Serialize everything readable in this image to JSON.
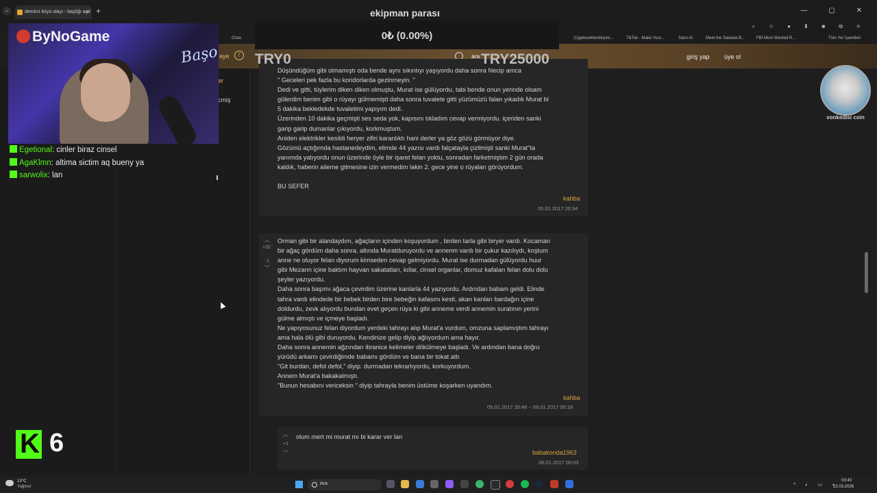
{
  "browser": {
    "tab_title": "demirci köyü olayı - başlığı açıl",
    "new_tab": "+",
    "window_controls": "— ▢ ✕",
    "bookmarks": [
      "Chao",
      "(1)gelecektenbiryolc...",
      "TikTok - Make Your...",
      "Satın Al",
      "Meet the Sakawa B...",
      "FBI Most Wanted R..."
    ],
    "all_bookmarks": "Tüm Yer İşaretleri",
    "tool_icons": "⌕ ☆ ● ⬇ ■ ⧉ ≡"
  },
  "site_header": {
    "left_text": "aye",
    "search_label": "ara",
    "login": "giriş yap",
    "signup": "üye ol"
  },
  "left_nav": {
    "item1": "er",
    "item2": "cmiş"
  },
  "entries": [
    {
      "text": "Düşündüğüm gibi olmamıştı oda bende aynı sıkıntıyı yaşıyordu daha sonra Necip amca\n\" Geceleri pek fazla bu koridorlarda gezinmeyin. \"\nDedi ve gitti, tüylerim diken diken olmuştu, Murat ise gülüyordu, tabi bende onun yerinde olsam\ngülerdim benim gibi o rüyayı gülmemişti daha sonra tuvalete gitti yüzümüzü falan yıkadık Murat bi\n5 dakika bekledekde tuvaletimi yapıyım dedi.\nÜzerinden 10 dakika geçmişti ses seda yok, kapısını tıkladım cevap vermiyordu. içeriden sanki\ngarip garip dumanlar çıkıyordu, korkmuştum.\nAniden elektrikler kesildi heryer zifiri karanlıktı hani derler ya göz gözü görmüyor diye.\nGözümü açtığımda hastanedeydim, elimde 44 yazısı vardı falçatayla çizilmişti sanki Murat\"ta\nyanımda yatıyordu onun üzerinde öyle bir işaret felan yoktu, sonradan farketmiştim 2 gün orada\nkaldık, haberin aileme gitmesine izin vermedim lakin 2. gece yine o rüyaları görüyordum.\n\nBU SEFER",
      "author": "kahba",
      "date": "05.01.2017 20:34"
    },
    {
      "text": "Orman gibi bir alandaydım, ağaçların içinden koşuyordum , birden tarla gibi biryer vardı. Kocaman\nbir ağaç gördüm daha sonra, altında Muratduruyordu ve annenm vardı bir çukur kazılıydı, koştum\nanne ne oluyor felan diyorum kimseden cevap gelmiyordu. Murat ise durmadan gülüyordu huur\ngibi Mezarın içine baktım hayvan sakatatları, kıllar, cinsel organlar, domuz kafaları felan dolu dolu\nşeyler yazıyordu.\nDaha sonra başımı ağaca çevirdim üzerine kanlarla 44 yazıyordu. Ardından babam geldi. Elinde\ntahra vardı elindede bir bebek birden bire bebeğin kafasını kesti, akan kanları bardağın içine\ndoldurdu, zevk alıyordu bundan evet geçen rüya ki gibi anneme verdi annemin suratının yerini\ngülme almıştı ve içmeye başladı.\nNe yapıyosunuz felan diyordum yerdeki tahrayı alıp Murat'a vurdum, omzuna saplamıştım tahrayı\nama hala ölü gibi duruyordu. Kendinize gelip diyip ağlıyordum ama hayır.\nDaha sonra annemin ağzından ibranice kelimeler dökülmeye başladı. Ve ardından bana doğru\nyürüdü arkamı çevirdiğimde babamı gördüm ve bana bir tokat attı\n\"Git burdan, defol defol,\" diyip. durmadan tekrarlıyordu, korkuyordum.\nAnnem Murat'a bakakalmıştı.\n\"Bunun hesabını vericeksin \" diyip tahrayla benim üstüme koşarken uyandım.",
      "author": "kahba",
      "date": "05.01.2017 20:46 ~ 06.01.2017 00:16",
      "upvotes": "+32",
      "downvotes": "-1"
    },
    {
      "text": "olum mert mi murat mı bi karar ver lan",
      "author": "babakonda1963",
      "date": "06.01.2017 00:03",
      "upvotes": "+1"
    }
  ],
  "overlay": {
    "title": "ekipman parası",
    "value": "0₺ (0.00%)",
    "min": "TRY0",
    "max": "TRY25000"
  },
  "stream": {
    "logo": "ByNoGame",
    "neon_sign": "Başo",
    "chat": [
      {
        "user": "Egetional",
        "message": "cinler biraz cinsel"
      },
      {
        "user": "AgaKlmn",
        "message": "altima sictim aq bueny ya"
      },
      {
        "user": "sarwolix",
        "message": "lan"
      }
    ],
    "viewer_count": "6",
    "badge_label": "vonkedisi coin"
  },
  "taskbar": {
    "temp": "13°C",
    "condition": "Yağmur",
    "search_placeholder": "Ara",
    "time": "03:40",
    "date": "22.03.2026"
  }
}
